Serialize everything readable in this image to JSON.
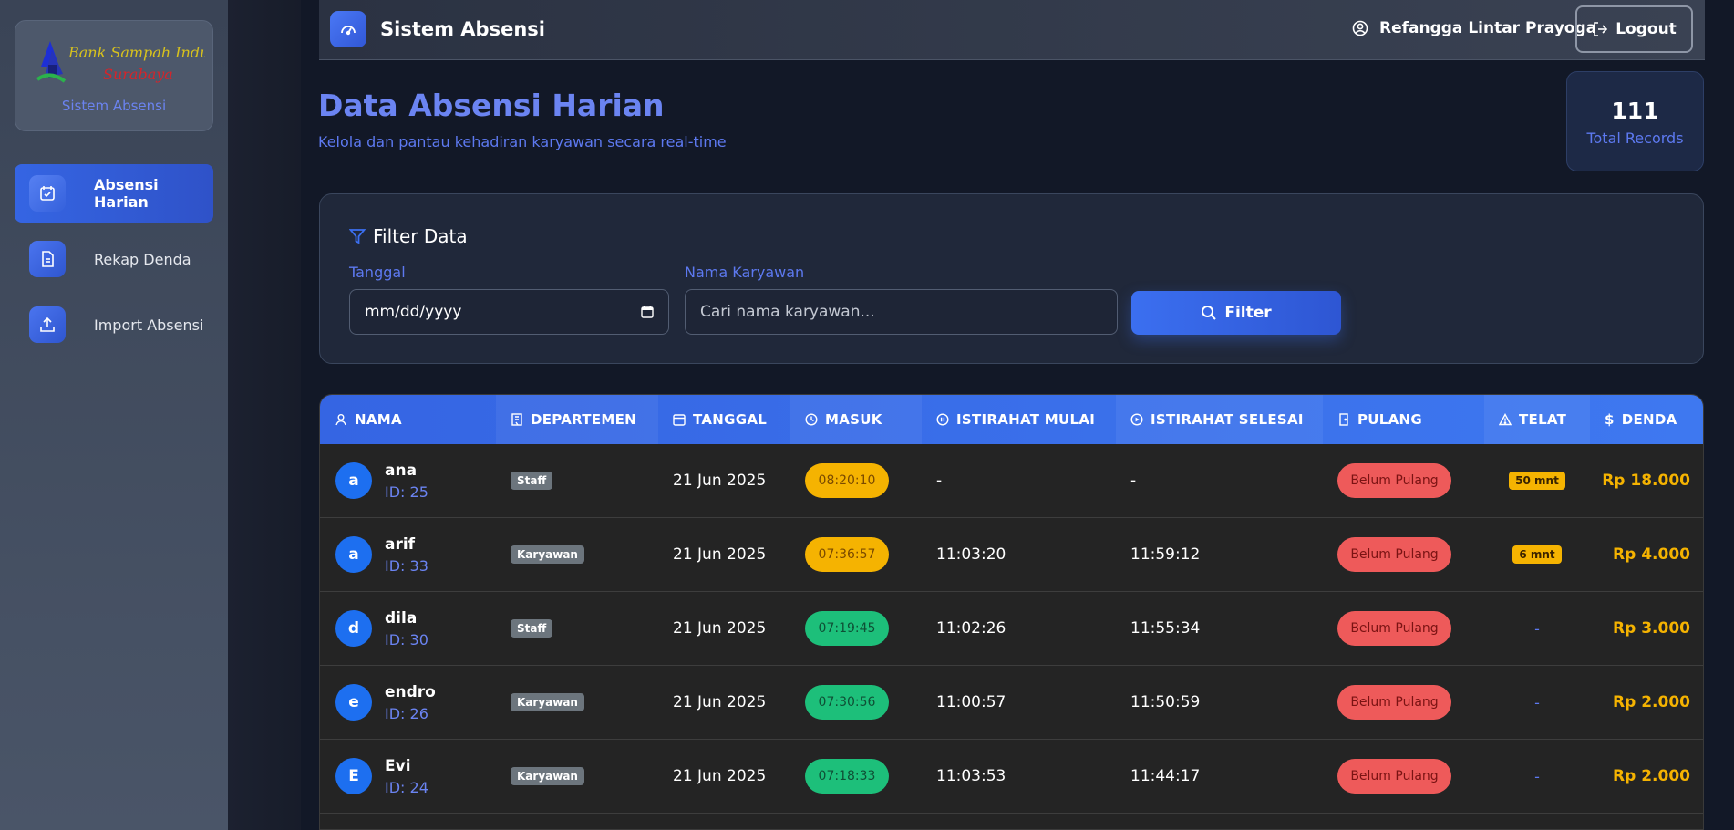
{
  "sidebar": {
    "logo_text_line1": "Bank Sampah Induk",
    "logo_text_line2": "Surabaya",
    "logo_sub": "Sistem Absensi",
    "items": [
      {
        "label": "Absensi Harian",
        "icon": "calendar-check-icon",
        "active": true
      },
      {
        "label": "Rekap Denda",
        "icon": "document-icon",
        "active": false
      },
      {
        "label": "Import Absensi",
        "icon": "upload-icon",
        "active": false
      }
    ]
  },
  "topbar": {
    "title": "Sistem Absensi",
    "user_name": "Refangga Lintar Prayoga",
    "logout_label": "Logout"
  },
  "header": {
    "title": "Data Absensi Harian",
    "subtitle": "Kelola dan pantau kehadiran karyawan secara real-time"
  },
  "stats": {
    "total": "111",
    "label": "Total Records"
  },
  "filter": {
    "title": "Filter Data",
    "date_label": "Tanggal",
    "date_placeholder": "mm/dd/yyyy",
    "name_label": "Nama Karyawan",
    "name_placeholder": "Cari nama karyawan...",
    "button_label": "Filter"
  },
  "table": {
    "columns": [
      "NAMA",
      "DEPARTEMEN",
      "TANGGAL",
      "MASUK",
      "ISTIRAHAT MULAI",
      "ISTIRAHAT SELESAI",
      "PULANG",
      "TELAT",
      "DENDA"
    ],
    "rows": [
      {
        "initial": "a",
        "name": "ana",
        "id": "ID: 25",
        "dept": "Staff",
        "date": "21 Jun 2025",
        "masuk": "08:20:10",
        "masuk_status": "late",
        "break_start": "-",
        "break_end": "-",
        "pulang": "Belum Pulang",
        "telat": "50 mnt",
        "denda": "Rp 18.000"
      },
      {
        "initial": "a",
        "name": "arif",
        "id": "ID: 33",
        "dept": "Karyawan",
        "date": "21 Jun 2025",
        "masuk": "07:36:57",
        "masuk_status": "late",
        "break_start": "11:03:20",
        "break_end": "11:59:12",
        "pulang": "Belum Pulang",
        "telat": "6 mnt",
        "denda": "Rp 4.000"
      },
      {
        "initial": "d",
        "name": "dila",
        "id": "ID: 30",
        "dept": "Staff",
        "date": "21 Jun 2025",
        "masuk": "07:19:45",
        "masuk_status": "ok",
        "break_start": "11:02:26",
        "break_end": "11:55:34",
        "pulang": "Belum Pulang",
        "telat": "-",
        "denda": "Rp 3.000"
      },
      {
        "initial": "e",
        "name": "endro",
        "id": "ID: 26",
        "dept": "Karyawan",
        "date": "21 Jun 2025",
        "masuk": "07:30:56",
        "masuk_status": "ok",
        "break_start": "11:00:57",
        "break_end": "11:50:59",
        "pulang": "Belum Pulang",
        "telat": "-",
        "denda": "Rp 2.000"
      },
      {
        "initial": "E",
        "name": "Evi",
        "id": "ID: 24",
        "dept": "Karyawan",
        "date": "21 Jun 2025",
        "masuk": "07:18:33",
        "masuk_status": "ok",
        "break_start": "11:03:53",
        "break_end": "11:44:17",
        "pulang": "Belum Pulang",
        "telat": "-",
        "denda": "Rp 2.000"
      }
    ]
  }
}
